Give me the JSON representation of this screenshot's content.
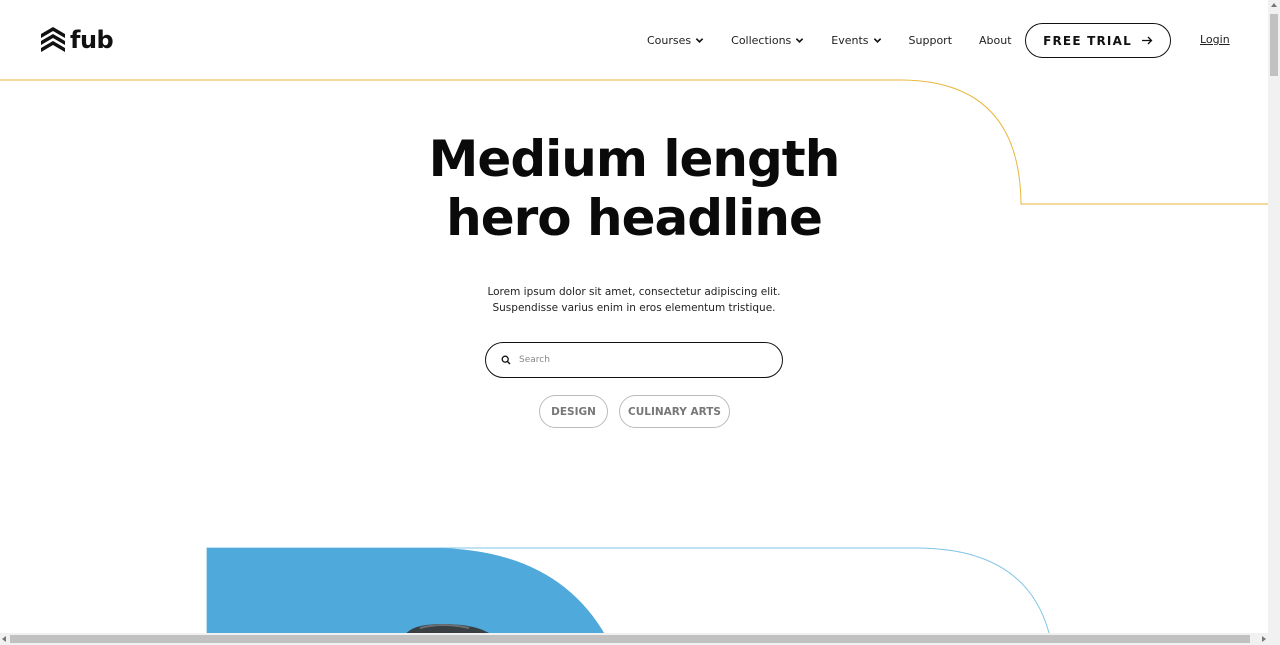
{
  "brand": {
    "name": "fub",
    "logo_icon": "stacked-chevrons-logo-icon"
  },
  "nav": {
    "items": [
      {
        "label": "Courses",
        "has_dropdown": true
      },
      {
        "label": "Collections",
        "has_dropdown": true
      },
      {
        "label": "Events",
        "has_dropdown": true
      },
      {
        "label": "Support",
        "has_dropdown": false
      },
      {
        "label": "About",
        "has_dropdown": false
      }
    ],
    "cta_label": "FREE TRIAL",
    "cta_icon": "arrow-right-icon",
    "login_label": "Login"
  },
  "hero": {
    "headline_line1": "Medium length",
    "headline_line2": "hero headline",
    "subtext_line1": "Lorem ipsum dolor sit amet, consectetur adipiscing elit.",
    "subtext_line2": "Suspendisse varius enim in eros elementum tristique.",
    "search_placeholder": "Search",
    "search_value": "",
    "tags": [
      "DESIGN",
      "CULINARY ARTS"
    ]
  },
  "colors": {
    "accent_orange": "#e8b53a",
    "accent_blue": "#4ea8d9",
    "text": "#0a0a0a",
    "tag_text": "#777777"
  }
}
